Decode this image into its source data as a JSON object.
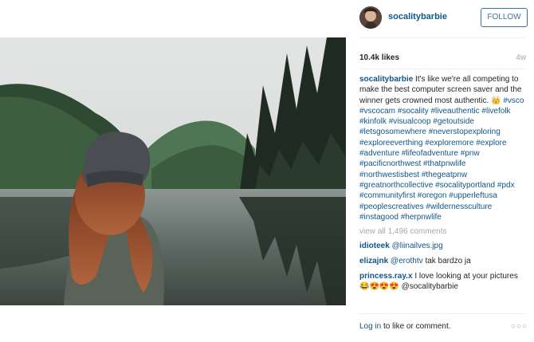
{
  "header": {
    "username": "socalitybarbie",
    "follow_label": "FOLLOW"
  },
  "post": {
    "likes": "10.4k likes",
    "age": "4w",
    "caption_user": "socalitybarbie",
    "caption_text": "It's like we're all competing to make the best computer screen saver and the winner gets crowned most authentic. 👑",
    "hashtags": [
      "#vsco",
      "#vscocam",
      "#socality",
      "#liveauthentic",
      "#livefolk",
      "#kinfolk",
      "#visualcoop",
      "#getoutside",
      "#letsgosomewhere",
      "#neverstopexploring",
      "#exploreeverthing",
      "#exploremore",
      "#explore",
      "#adventure",
      "#lifeofadventure",
      "#pnw",
      "#pacificnorthwest",
      "#thatpnwlife",
      "#northwestisbest",
      "#thegeatpnw",
      "#greatnorthcollective",
      "#socalityportland",
      "#pdx",
      "#communityfirst",
      "#oregon",
      "#upperleftusa",
      "#peoplescreatives",
      "#wildernessculture",
      "#instagood",
      "#herpnwlife"
    ],
    "view_all": "view all 1,496 comments"
  },
  "comments": [
    {
      "user": "idioteek",
      "mention": "@liinailves.jpg",
      "text": ""
    },
    {
      "user": "elizajnk",
      "mention": "@erothtv",
      "text": "tak bardzo ja"
    },
    {
      "user": "princess.ray.x",
      "mention": "",
      "text": "I love looking at your pictures😂😍😍😍 @socalitybarbie"
    }
  ],
  "footer": {
    "login_label": "Log in",
    "login_suffix": " to like or comment.",
    "more_icon_text": "○○○"
  },
  "colors": {
    "link": "#125688",
    "follow_border": "#3f729b",
    "muted": "#a5a7aa"
  },
  "icons": {
    "more": "more-options-icon"
  }
}
